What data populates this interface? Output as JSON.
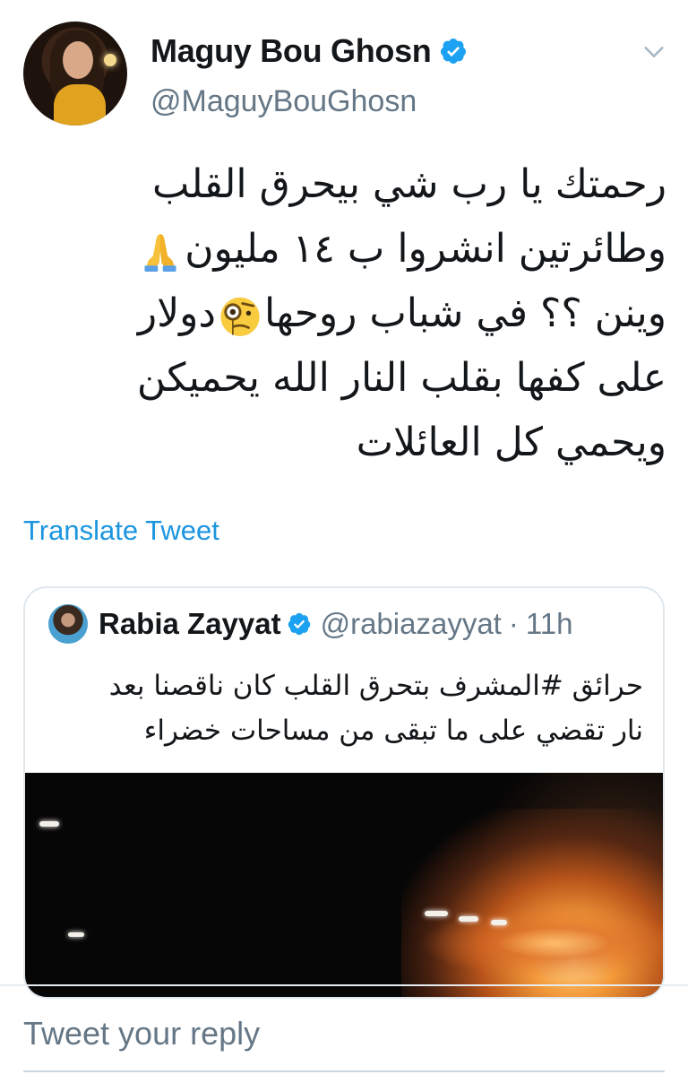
{
  "author": {
    "display_name": "Maguy Bou Ghosn",
    "handle": "@MaguyBouGhosn",
    "verified": true
  },
  "tweet": {
    "lines": [
      "رحمتك يا رب شي بيحرق القلب",
      "وطائرتين انشروا ب ١٤ مليون",
      "دولار",
      "وينن ؟؟ في شباب روحها",
      "على كفها بقلب النار الله يحميكن",
      "ويحمي كل العائلات"
    ],
    "emojis": [
      "folded-hands",
      "face-with-monocle"
    ]
  },
  "translate_label": "Translate Tweet",
  "quoted_tweet": {
    "display_name": "Rabia Zayyat",
    "handle": "@rabiazayyat",
    "separator": "·",
    "time": "11h",
    "verified": true,
    "lines": [
      "حرائق #المشرف بتحرق القلب كان ناقصنا بعد",
      "نار تقضي على ما تبقى من مساحات خضراء"
    ]
  },
  "reply": {
    "placeholder": "Tweet your reply"
  },
  "colors": {
    "accent": "#1b95e0",
    "verified": "#1da1f2",
    "secondary_text": "#657786",
    "border": "#e1e8ed"
  },
  "icons": [
    "verified-badge-icon",
    "chevron-down-icon"
  ]
}
